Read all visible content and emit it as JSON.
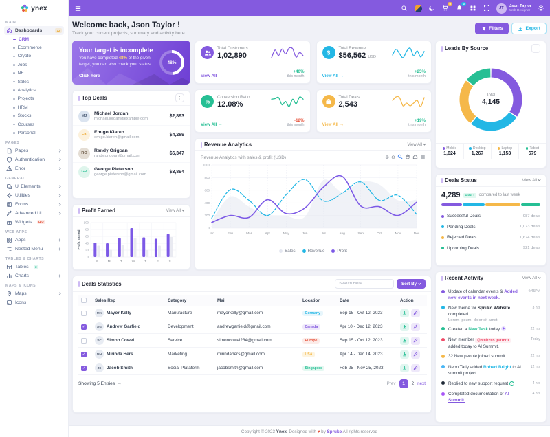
{
  "brand": {
    "name": "ynex"
  },
  "header": {
    "user": {
      "name": "Json Taylor",
      "role": "Web Designer",
      "initials": "JT"
    },
    "cart_count": "5",
    "notification_count": "3"
  },
  "sidebar": {
    "sections": [
      {
        "label": "MAIN"
      },
      {
        "label": "PAGES"
      },
      {
        "label": "GENERAL"
      },
      {
        "label": "WEB APPS"
      },
      {
        "label": "TABLES & CHARTS"
      },
      {
        "label": "MAPS & ICONS"
      }
    ],
    "dashboards_label": "Dashboards",
    "dashboards_badge": "12",
    "submenu": [
      "CRM",
      "Ecommerce",
      "Crypto",
      "Jobs",
      "NFT",
      "Sales",
      "Analytics",
      "Projects",
      "HRM",
      "Stocks",
      "Courses",
      "Personal"
    ],
    "pages": [
      "Pages",
      "Authentication",
      "Error"
    ],
    "general": [
      "Ui Elements",
      "Utilities",
      "Forms",
      "Advanced Ui",
      "Widgets"
    ],
    "widgets_badge": "Hot",
    "webapps": [
      "Apps",
      "Nested Menu"
    ],
    "tables": [
      "Tables",
      "Charts"
    ],
    "tables_badge": "3",
    "maps": [
      "Maps",
      "Icons"
    ]
  },
  "welcome": {
    "title": "Welcome back, Json Taylor !",
    "subtitle": "Track your current projects, summary and activity here.",
    "filters": "Filters",
    "export": "Export"
  },
  "banner": {
    "title": "Your target is incomplete",
    "text_before": "You have completed ",
    "percent": "48%",
    "text_after": " of the given target, you can also check your status.",
    "link": "Click here",
    "progress": "48%"
  },
  "stats": [
    {
      "label": "Total Customers",
      "value": "1,02,890",
      "suffix": "",
      "view_all": "View All",
      "arrow": "→",
      "delta": "+40%",
      "period": "this month",
      "color": "#845adf",
      "delta_color": "#26bf94"
    },
    {
      "label": "Total Revenue",
      "value": "$56,562",
      "suffix": "USD",
      "view_all": "View All",
      "arrow": "→",
      "delta": "+25%",
      "period": "this month",
      "color": "#23b7e5",
      "delta_color": "#26bf94"
    },
    {
      "label": "Conversion Ratio",
      "value": "12.08%",
      "suffix": "",
      "view_all": "View All",
      "arrow": "→",
      "delta": "-12%",
      "period": "this month",
      "color": "#26bf94",
      "delta_color": "#e6533c"
    },
    {
      "label": "Total Deals",
      "value": "2,543",
      "suffix": "",
      "view_all": "View All",
      "arrow": "→",
      "delta": "+19%",
      "period": "this month",
      "color": "#f5b849",
      "delta_color": "#26bf94"
    }
  ],
  "top_deals": {
    "title": "Top Deals",
    "rows": [
      {
        "name": "Michael Jordan",
        "email": "michael.jordan@example.com",
        "amount": "$2,893",
        "initials": "MJ",
        "bg": "#dbe4f0",
        "fg": "#51617a"
      },
      {
        "name": "Emigo Kiaren",
        "email": "emigo.kiaren@gmail.com",
        "amount": "$4,289",
        "initials": "EK",
        "bg": "#fcf1dc",
        "fg": "#eda72f"
      },
      {
        "name": "Randy Origoan",
        "email": "randy.origoan@gmail.com",
        "amount": "$6,347",
        "initials": "RO",
        "bg": "#e4ddd4",
        "fg": "#6d5b48"
      },
      {
        "name": "George Pieterson",
        "email": "george.pieterson@gmail.com",
        "amount": "$3,894",
        "initials": "GP",
        "bg": "#def5ec",
        "fg": "#26bf94"
      }
    ]
  },
  "profit_earned": {
    "title": "Profit Earned",
    "view_all": "View All"
  },
  "revenue": {
    "title": "Revenue Analytics",
    "view_all": "View All",
    "subtitle": "Revenue Analytics with sales & profit (USD)"
  },
  "leads": {
    "title": "Leads By Source",
    "center_label": "Total",
    "center_value": "4,145",
    "legend_values": [
      "1,624",
      "1,267",
      "1,153",
      "679"
    ]
  },
  "deals_status": {
    "title": "Deals Status",
    "view_all": "View All",
    "value": "4,289",
    "badge": "1.02 ↑",
    "note": "compared to last week",
    "rows": [
      {
        "label": "Successful Deals",
        "count": "987 deals",
        "num": 987,
        "color": "#845adf"
      },
      {
        "label": "Pending Deals",
        "count": "1,073 deals",
        "num": 1073,
        "color": "#23b7e5"
      },
      {
        "label": "Rejected Deals",
        "count": "1,674 deals",
        "num": 1674,
        "color": "#f5b849"
      },
      {
        "label": "Upcoming Deals",
        "count": "921 deals",
        "num": 921,
        "color": "#26bf94"
      }
    ]
  },
  "activity": {
    "title": "Recent Activity",
    "view_all": "View All",
    "items": [
      {
        "text": "Update of calendar events & ",
        "link": "Added new events in next week.",
        "link_color": "#845adf",
        "time": "4:45PM",
        "dot": "#845adf"
      },
      {
        "text": "New theme for ",
        "bold": "Spruko Website",
        "text2": " completed",
        "sub": "Lorem ipsum, dolor sit amet.",
        "time": "3 hrs",
        "dot": "#23b7e5"
      },
      {
        "text": "Created a ",
        "link": "New Task",
        "link_color": "#26bf94",
        "text2": " today",
        "time": "22 hrs",
        "dot": "#26bf94"
      },
      {
        "text": "New member ",
        "badge": "@andreas gurrero",
        "badge_fg": "#ef4b68",
        "badge_bg": "#fdeef1",
        "text2": " added today to AI Summit.",
        "time": "Today",
        "dot": "#ef4b68"
      },
      {
        "text": "32 New people joined summit.",
        "time": "22 hrs",
        "dot": "#f5b849"
      },
      {
        "text": "Neon Tarly added ",
        "link": "Robert Bright",
        "link_color": "#23b7e5",
        "text2": " to AI summit project.",
        "time": "12 hrs",
        "dot": "#49b6f5"
      },
      {
        "text": "Replied to new support request",
        "time": "4 hrs",
        "dot": "#1f2937"
      },
      {
        "text": "Completed documentation of ",
        "link": "AI Summit.",
        "link_color": "#845adf",
        "time": "4 hrs",
        "dot": "#a855f7"
      }
    ]
  },
  "table": {
    "title": "Deals Statistics",
    "search_placeholder": "Search Here",
    "sort_by": "Sort By",
    "columns": [
      "Sales Rep",
      "Category",
      "Mail",
      "Location",
      "Date",
      "Action"
    ],
    "rows": [
      {
        "name": "Mayor Kelly",
        "initials": "MK",
        "category": "Manufacture",
        "mail": "mayorkelly@gmail.com",
        "location": "Germany",
        "loc_fg": "#23b7e5",
        "loc_bg": "#e7f6fc",
        "date": "Sep 15 - Oct 12, 2023",
        "checked": false
      },
      {
        "name": "Andrew Garfield",
        "initials": "AG",
        "category": "Development",
        "mail": "andrewgarfield@gmail.com",
        "location": "Canada",
        "loc_fg": "#845adf",
        "loc_bg": "#efe9fb",
        "date": "Apr 10 - Dec 12, 2023",
        "checked": true
      },
      {
        "name": "Simon Cowel",
        "initials": "SC",
        "category": "Service",
        "mail": "simoncowel234@gmail.com",
        "location": "Europe",
        "loc_fg": "#e6533c",
        "loc_bg": "#fcebe8",
        "date": "Sep 15 - Oct 12, 2023",
        "checked": false
      },
      {
        "name": "Mirinda Hers",
        "initials": "MH",
        "category": "Marketing",
        "mail": "mirindahers@gmail.com",
        "location": "USA",
        "loc_fg": "#f5b849",
        "loc_bg": "#fdf4e0",
        "date": "Apr 14 - Dec 14, 2023",
        "checked": true
      },
      {
        "name": "Jacob Smith",
        "initials": "JS",
        "category": "Social Plataform",
        "mail": "jacobsmith@gmail.com",
        "location": "Singapore",
        "loc_fg": "#26bf94",
        "loc_bg": "#e4f8f1",
        "date": "Feb 25 - Nov 25, 2023",
        "checked": true
      }
    ],
    "showing": "Showing 5 Entries",
    "arrow": "→",
    "prev": "Prev",
    "page1": "1",
    "page2": "2",
    "next": "next"
  },
  "footer": {
    "text_before": "Copyright © 2023 ",
    "brand": "Ynex",
    "text_mid": ". Designed with ",
    "heart": "♥",
    "text_by": " by ",
    "spruko": "Spruko",
    "text_after": " All rights reserved"
  },
  "chart_data": [
    {
      "id": "spark-customers",
      "type": "line",
      "values": [
        38,
        62,
        45,
        65,
        50,
        68,
        66,
        40,
        55,
        44
      ],
      "color": "#845adf"
    },
    {
      "id": "spark-revenue",
      "type": "line",
      "values": [
        45,
        66,
        50,
        35,
        58,
        70,
        42,
        60,
        38,
        58
      ],
      "color": "#23b7e5"
    },
    {
      "id": "spark-conversion",
      "type": "line",
      "values": [
        58,
        60,
        64,
        38,
        50,
        32,
        58,
        42,
        66,
        58
      ],
      "color": "#26bf94"
    },
    {
      "id": "spark-deals",
      "type": "line",
      "values": [
        52,
        62,
        60,
        36,
        44,
        36,
        44,
        52,
        34,
        60
      ],
      "color": "#f5b849"
    },
    {
      "id": "profit-earned",
      "type": "bar",
      "title": "Profit Earned",
      "categories": [
        "S",
        "M",
        "T",
        "W",
        "T",
        "F",
        "S"
      ],
      "series": [
        {
          "name": "Profit",
          "values": [
            42,
            40,
            55,
            84,
            57,
            53,
            67
          ],
          "color": "#7c59e6"
        },
        {
          "name": "Benchmark",
          "values": [
            33,
            21,
            35,
            55,
            20,
            33,
            58
          ],
          "color": "#e9eaf1"
        }
      ],
      "ylabel": "Profit Earned",
      "ylim": [
        0,
        100
      ],
      "yticks": [
        0,
        20,
        40,
        60,
        80,
        100
      ],
      "grid": true
    },
    {
      "id": "revenue-analytics",
      "type": "line",
      "title": "Revenue Analytics with sales & profit (USD)",
      "x": [
        "Jan",
        "Feb",
        "Mar",
        "Apr",
        "May",
        "Jun",
        "Jul",
        "Aug",
        "Sep",
        "Oct",
        "Nov",
        "Dec"
      ],
      "series": [
        {
          "name": "Sales",
          "type": "area",
          "color": "#e4e7f0",
          "values": [
            120,
            500,
            340,
            210,
            190,
            180,
            760,
            570,
            730,
            690,
            440,
            450
          ]
        },
        {
          "name": "Revenue",
          "type": "dashed-line",
          "color": "#23b7e5",
          "values": [
            160,
            610,
            440,
            200,
            530,
            770,
            430,
            550,
            730,
            440,
            520,
            220
          ]
        },
        {
          "name": "Profit",
          "type": "line",
          "color": "#7c59e6",
          "values": [
            90,
            200,
            170,
            450,
            230,
            320,
            650,
            820,
            350,
            340,
            200,
            410
          ]
        }
      ],
      "ylim": [
        0,
        1000
      ],
      "yticks": [
        0,
        200,
        400,
        600,
        800,
        1000
      ],
      "legend_position": "bottom",
      "grid": true
    },
    {
      "id": "leads-donut",
      "type": "pie",
      "labels": [
        "Mobile",
        "Desktop",
        "Laptop",
        "Tablet"
      ],
      "values": [
        1624,
        1267,
        1153,
        679
      ],
      "colors": [
        "#845adf",
        "#23b7e5",
        "#f5b849",
        "#26bf94"
      ],
      "center_label": "Total",
      "center_value": "4,145"
    }
  ]
}
